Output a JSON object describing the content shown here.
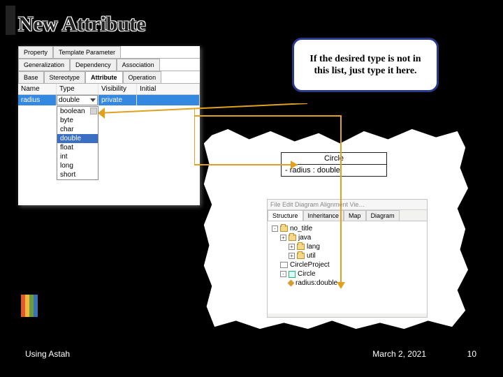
{
  "title": "New Attribute",
  "callout": "If the desired type is not in this list, just type it here.",
  "panel": {
    "tabs_row1": [
      "Property",
      "Template Parameter"
    ],
    "tabs_row2": [
      "Generalization",
      "Dependency",
      "Association"
    ],
    "tabs_row3": [
      "Base",
      "Stereotype",
      "Attribute",
      "Operation"
    ],
    "active_tab": "Attribute",
    "columns": {
      "name": "Name",
      "type": "Type",
      "visibility": "Visibility",
      "initial": "Initial"
    },
    "row": {
      "name": "radius",
      "type": "double",
      "visibility": "private"
    },
    "type_options": [
      "boolean",
      "byte",
      "char",
      "double",
      "float",
      "int",
      "long",
      "short"
    ],
    "type_selected": "double"
  },
  "uml": {
    "class_name": "Circle",
    "attribute_line": "- radius : double"
  },
  "struct": {
    "menubar": "File  Edit  Diagram  Alignment  Vie…",
    "tabs": [
      "Structure",
      "Inheritance",
      "Map",
      "Diagram"
    ],
    "active": "Structure",
    "tree": {
      "root": "no_title",
      "children": [
        {
          "label": "java",
          "icon": "pkg"
        },
        {
          "label": "lang",
          "icon": "pkg"
        },
        {
          "label": "util",
          "icon": "pkg"
        },
        {
          "label": "CircleProject",
          "icon": "cd"
        },
        {
          "label": "Circle",
          "icon": "cls",
          "children": [
            {
              "label": "radius:double",
              "icon": "attr"
            }
          ]
        }
      ]
    }
  },
  "footer": {
    "left": "Using Astah",
    "date": "March 2, 2021",
    "page": "10"
  }
}
